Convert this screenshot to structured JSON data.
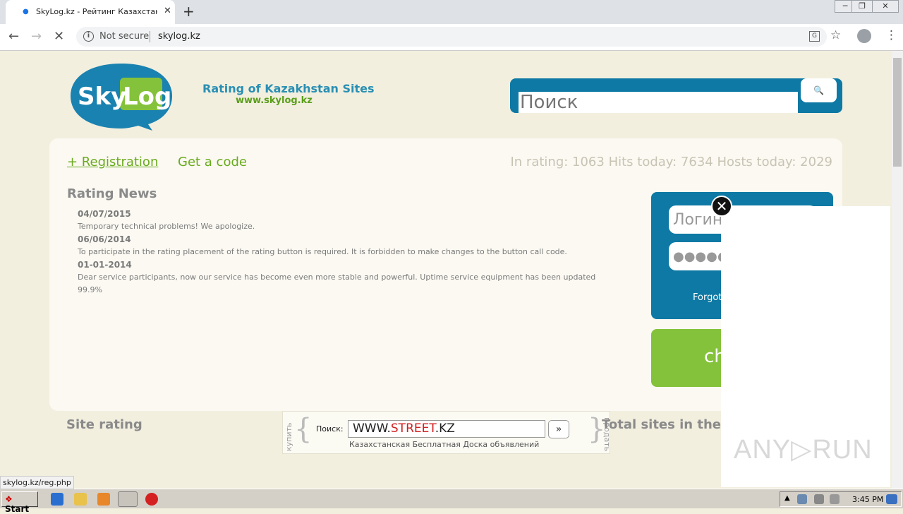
{
  "browser": {
    "tab_title": "SkyLog.kz - Рейтинг Казахстански",
    "security_label": "Not secure",
    "url": "skylog.kz",
    "status_url": "skylog.kz/reg.php"
  },
  "header": {
    "logo_text_sky": "Sky",
    "logo_text_log": "Log",
    "tagline": "Rating of Kazakhstan Sites",
    "site": "www.skylog.kz",
    "search_placeholder": "Поиск"
  },
  "panel": {
    "registration_link": "+ Registration",
    "code_link": "Get a code",
    "stats": "In rating: 1063 Hits today: 7634 Hosts today: 2029",
    "news_title": "Rating News",
    "news": [
      {
        "date": "04/07/2015",
        "text": "Temporary technical problems! We apologize."
      },
      {
        "date": "06/06/2014",
        "text": "To participate in the rating placement of the rating button is required. It is forbidden to make changes to the button call code."
      },
      {
        "date": "01-01-2014",
        "text": "Dear service participants, now our service has become even more stable and powerful. Uptime service equipment has been updated 99.9%"
      }
    ]
  },
  "login": {
    "login_placeholder": "Логин",
    "password_mask": "●●●●●",
    "forgot": "Forgot",
    "green_button": "ch"
  },
  "ad": {
    "buy": "купить",
    "sell": "продать",
    "label": "Поиск:",
    "www": "WWW.",
    "street": "STREET",
    "kz": ".KZ",
    "go": "»",
    "desc": "Казахстанская Бесплатная Доска объявлений"
  },
  "sections": {
    "site_rating": "Site rating",
    "total_sites": "Total sites in the c"
  },
  "watermark": "ANY▷RUN",
  "taskbar": {
    "start": "Start",
    "clock": "3:45 PM"
  },
  "colors": {
    "brand_blue": "#0d79a4",
    "brand_green": "#85c23b",
    "page_bg": "#f2efdf"
  }
}
